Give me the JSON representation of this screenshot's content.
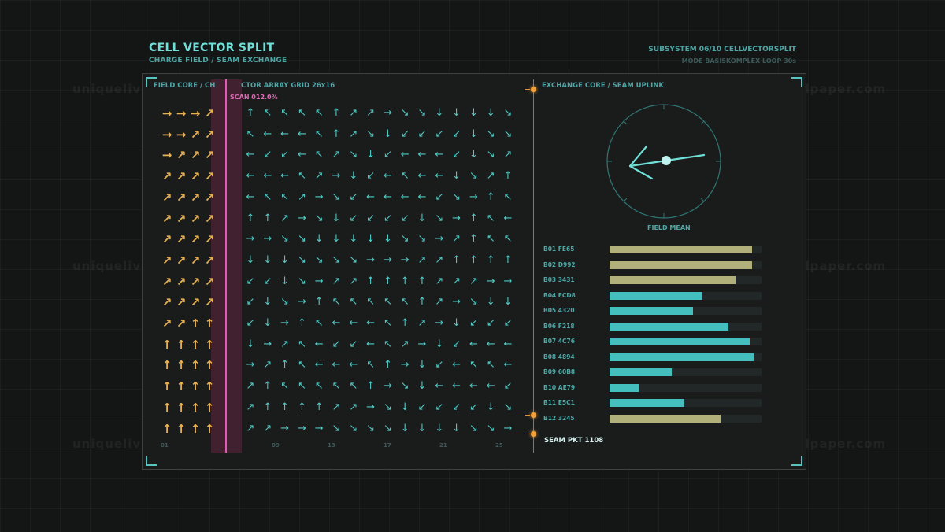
{
  "header": {
    "title": "CELL VECTOR SPLIT",
    "subtitle": "CHARGE FIELD / SEAM EXCHANGE",
    "subsystem": "SUBSYSTEM 06/10  CELLVECTORSPLIT",
    "mode": "MODE BASISKOMPLEX  LOOP 30s"
  },
  "watermark": "uniquelivewallpaper.com",
  "left_panel": {
    "label_core": "FIELD CORE / CH",
    "label_array": "CTOR ARRAY  GRID 26x16",
    "scan_label": "SCAN 012.0%",
    "scan_percent": 12.0,
    "x_ticks": [
      "01",
      "09",
      "13",
      "17",
      "21",
      "25"
    ]
  },
  "right_panel": {
    "label": "EXCHANGE CORE / SEAM UPLINK",
    "dial_label": "FIELD MEAN",
    "seam_packet": "SEAM PKT 1108",
    "bars": [
      {
        "label": "B01 FE65",
        "value": 0.94,
        "color": "#b1b07a"
      },
      {
        "label": "B02 D992",
        "value": 0.94,
        "color": "#b1b07a"
      },
      {
        "label": "B03 3431",
        "value": 0.83,
        "color": "#b1b07a"
      },
      {
        "label": "B04 FCD8",
        "value": 0.61,
        "color": "#45bfbe"
      },
      {
        "label": "B05 4320",
        "value": 0.55,
        "color": "#45bfbe"
      },
      {
        "label": "B06 F218",
        "value": 0.78,
        "color": "#45bfbe"
      },
      {
        "label": "B07 4C76",
        "value": 0.92,
        "color": "#45bfbe"
      },
      {
        "label": "B08 4894",
        "value": 0.95,
        "color": "#45bfbe"
      },
      {
        "label": "B09 60B8",
        "value": 0.41,
        "color": "#45bfbe"
      },
      {
        "label": "B10 AE79",
        "value": 0.19,
        "color": "#45bfbe"
      },
      {
        "label": "B11 E5C1",
        "value": 0.49,
        "color": "#45bfbe"
      },
      {
        "label": "B12 3245",
        "value": 0.73,
        "color": "#b1b07a"
      }
    ]
  },
  "colors": {
    "accent": "#6fe0d8",
    "warm_arrow": "#e8b154",
    "cool_arrow": "#4fc9c3",
    "scan": "#e15ab6",
    "node": "#f0a03a"
  },
  "icons": [
    "arrow-icon",
    "dial-needle-icon",
    "node-icon"
  ]
}
